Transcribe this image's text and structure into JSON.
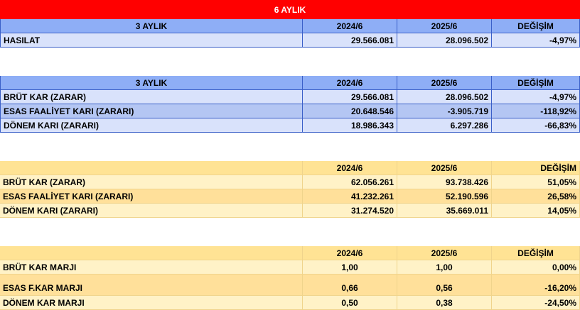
{
  "title": "6 AYLIK",
  "table1": {
    "header": [
      "3 AYLIK",
      "2024/6",
      "2025/6",
      "DEĞİŞİM"
    ],
    "rows": [
      [
        "HASILAT",
        "29.566.081",
        "28.096.502",
        "-4,97%"
      ]
    ]
  },
  "table2": {
    "header": [
      "3 AYLIK",
      "2024/6",
      "2025/6",
      "DEĞİŞİM"
    ],
    "rows": [
      [
        "BRÜT KAR (ZARAR)",
        "29.566.081",
        "28.096.502",
        "-4,97%"
      ],
      [
        "ESAS FAALİYET KARI (ZARARI)",
        "20.648.546",
        "-3.905.719",
        "-118,92%"
      ],
      [
        "DÖNEM KARI (ZARARI)",
        "18.986.343",
        "6.297.286",
        "-66,83%"
      ]
    ]
  },
  "table3": {
    "header": [
      "",
      "2024/6",
      "2025/6",
      "DEĞİŞİM"
    ],
    "rows": [
      [
        "BRÜT KAR (ZARAR)",
        "62.056.261",
        "93.738.426",
        "51,05%"
      ],
      [
        "ESAS FAALİYET KARI (ZARARI)",
        "41.232.261",
        "52.190.596",
        "26,58%"
      ],
      [
        "DÖNEM KARI (ZARARI)",
        "31.274.520",
        "35.669.011",
        "14,05%"
      ]
    ]
  },
  "table4": {
    "header": [
      "",
      "2024/6",
      "2025/6",
      "DEĞİŞİM"
    ],
    "rows": [
      [
        "BRÜT KAR MARJI",
        "1,00",
        "1,00",
        "0,00%"
      ],
      [
        "ESAS F.KAR MARJI",
        "0,66",
        "0,56",
        "-16,20%"
      ],
      [
        "DÖNEM KAR MARJI",
        "0,50",
        "0,38",
        "-24,50%"
      ]
    ]
  },
  "colors": {
    "title_bg": "#ff0000",
    "blue_header": "#8eaef6",
    "blue_row": "#d9e2fb",
    "yellow_header": "#ffe394",
    "yellow_row": "#fff2c7"
  }
}
